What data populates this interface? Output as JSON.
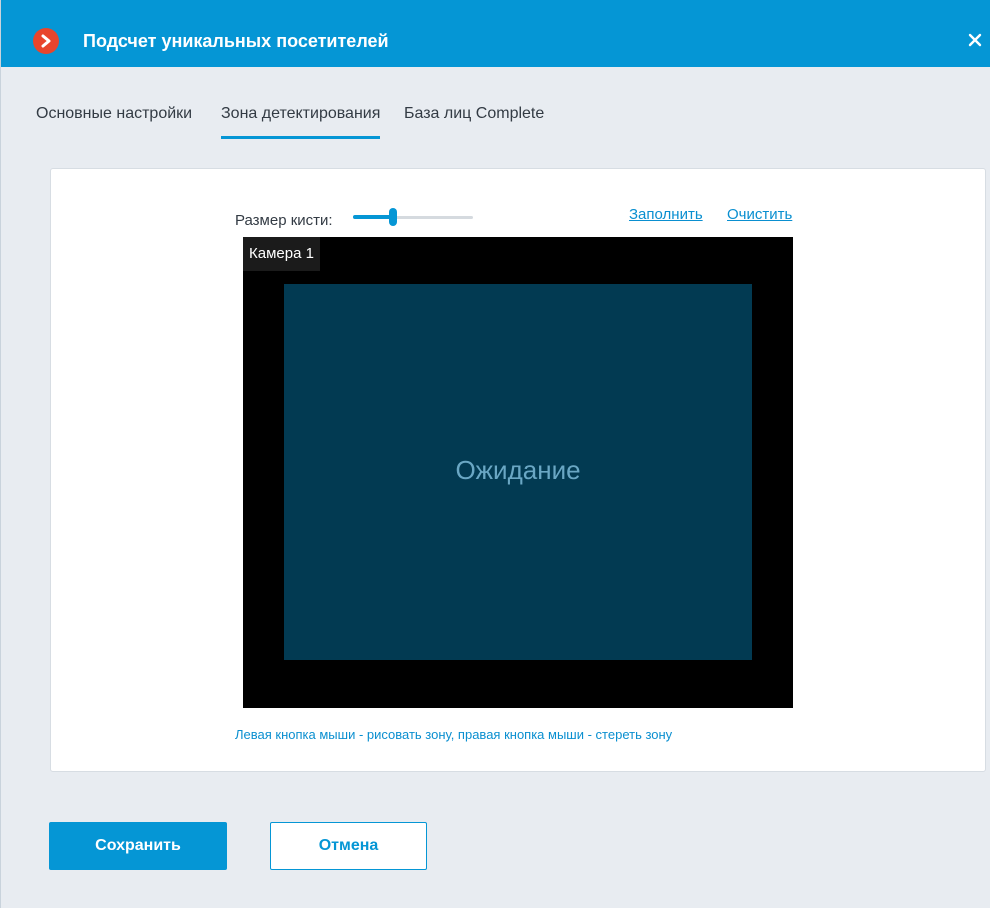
{
  "window": {
    "title": "Подсчет уникальных посетителей",
    "accent_color": "#0596d5",
    "logo_icon": "chevron-right-logo-icon",
    "close_icon": "close-icon"
  },
  "tabs": [
    {
      "label": "Основные настройки",
      "active": false
    },
    {
      "label": "Зона детектирования",
      "active": true
    },
    {
      "label": "База лиц Complete",
      "active": false
    }
  ],
  "brush": {
    "label": "Размер кисти:",
    "value_fraction": 0.33
  },
  "actions": {
    "fill_label": "Заполнить",
    "clear_label": "Очистить"
  },
  "camera": {
    "name": "Камера 1",
    "status": "Ожидание"
  },
  "hint": "Левая кнопка мыши - рисовать зону, правая кнопка мыши - стереть зону",
  "buttons": {
    "save_label": "Сохранить",
    "cancel_label": "Отмена"
  }
}
